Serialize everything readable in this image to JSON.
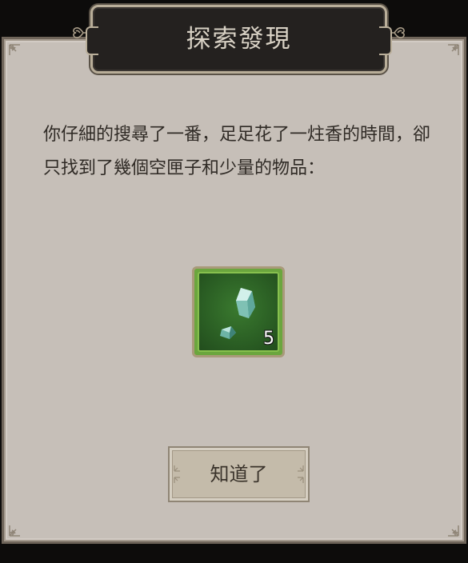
{
  "dialog": {
    "title": "探索發現",
    "message": "你仔細的搜尋了一番，足足花了一炷香的時間，卻只找到了幾個空匣子和少量的物品：",
    "item": {
      "icon": "jade-ore-icon",
      "count": "5",
      "rarity_color": "#6ba63e"
    },
    "confirm_label": "知道了"
  },
  "colors": {
    "panel": "#c6bfb8",
    "title_plaque": "#24211f",
    "title_text": "#d9d2c5",
    "message_text": "#2f2a25",
    "button": "#c4bbaa"
  }
}
